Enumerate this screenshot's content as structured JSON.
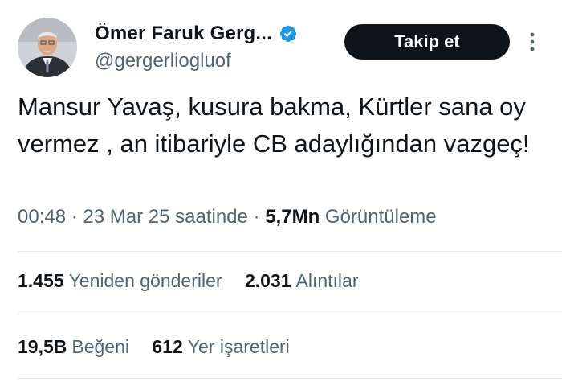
{
  "author": {
    "display_name": "Ömer Faruk Gerg...",
    "handle": "@gergerliogluof",
    "verified": true,
    "verified_color": "#1d9bf0"
  },
  "actions": {
    "follow_label": "Takip et",
    "more_icon": "more-vertical-icon"
  },
  "tweet": {
    "text": "Mansur Yavaş, kusura bakma, Kürtler sana oy vermez , an itibariyle CB adaylığından vazgeç!",
    "time": "00:48",
    "separator": "·",
    "date": "23 Mar 25 saatinde",
    "views_count": "5,7Mn",
    "views_label": "Görüntüleme"
  },
  "stats": {
    "reposts": {
      "count": "1.455",
      "label": "Yeniden gönderiler"
    },
    "quotes": {
      "count": "2.031",
      "label": "Alıntılar"
    },
    "likes": {
      "count": "19,5B",
      "label": "Beğeni"
    },
    "bookmarks": {
      "count": "612",
      "label": "Yer işaretleri"
    }
  },
  "colors": {
    "text": "#0f1419",
    "secondary": "#536471",
    "divider": "#e6e9ec",
    "button_bg": "#0f1419"
  }
}
